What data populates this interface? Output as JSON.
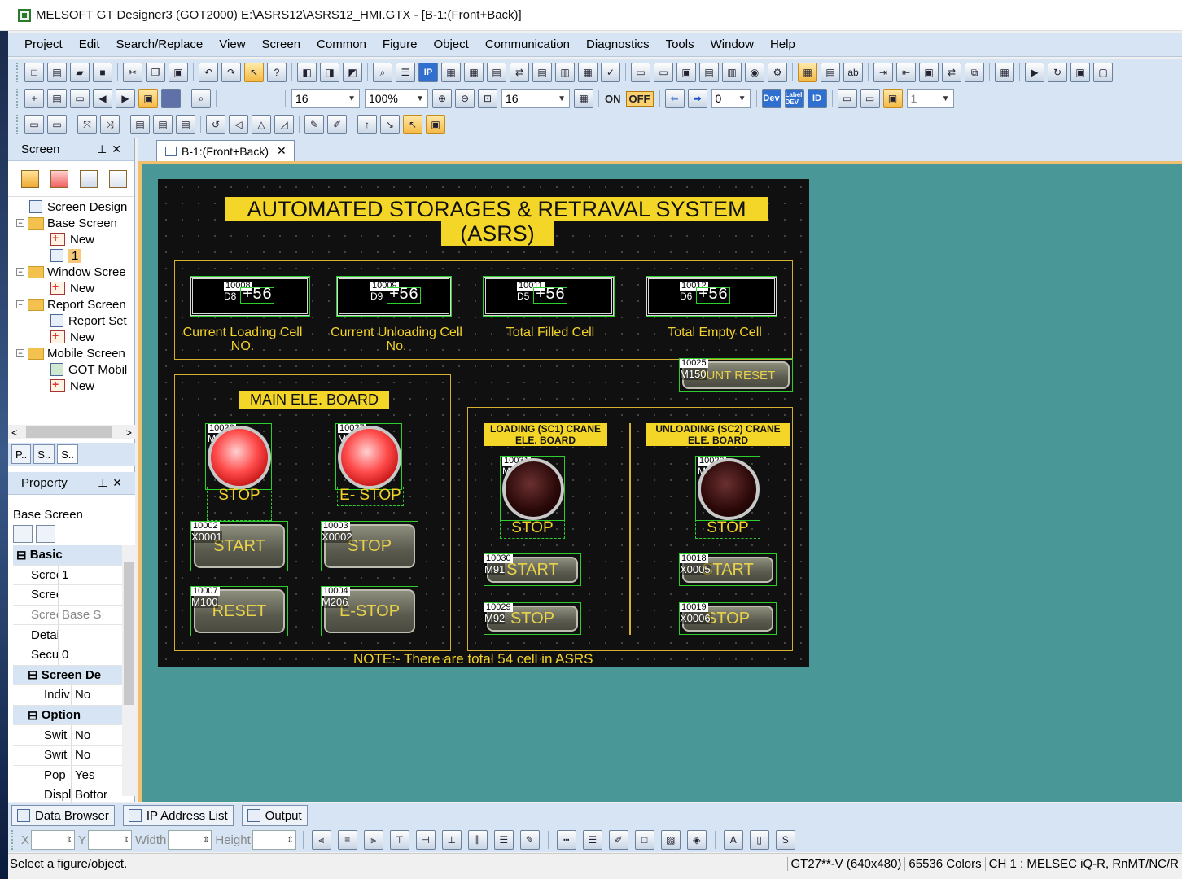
{
  "window": {
    "title": "MELSOFT GT Designer3 (GOT2000) E:\\ASRS12\\ASRS12_HMI.GTX - [B-1:(Front+Back)]"
  },
  "menu": [
    "Project",
    "Edit",
    "Search/Replace",
    "View",
    "Screen",
    "Common",
    "Figure",
    "Object",
    "Communication",
    "Diagnostics",
    "Tools",
    "Window",
    "Help"
  ],
  "toolbar2": {
    "font_size": "16",
    "zoom": "100%",
    "grid": "16",
    "on": "ON",
    "off": "OFF",
    "state": "0",
    "dev": "Dev",
    "label": "Label DEV",
    "id": "ID",
    "layer": "1"
  },
  "screen_panel": {
    "title": "Screen",
    "tree": [
      {
        "label": "Screen Design",
        "level": 1
      },
      {
        "label": "Base Screen",
        "level": 0
      },
      {
        "label": "New",
        "level": 2
      },
      {
        "label": "1",
        "level": 2
      },
      {
        "label": "Window Scree",
        "level": 0
      },
      {
        "label": "New",
        "level": 2
      },
      {
        "label": "Report Screen",
        "level": 0
      },
      {
        "label": "Report Set",
        "level": 2
      },
      {
        "label": "New",
        "level": 2
      },
      {
        "label": "Mobile Screen",
        "level": 0
      },
      {
        "label": "GOT Mobil",
        "level": 2
      },
      {
        "label": "New",
        "level": 2
      }
    ],
    "tabs": [
      "P..",
      "S..",
      "S.."
    ]
  },
  "property_panel": {
    "title": "Property",
    "object": "Base Screen",
    "rows": [
      {
        "type": "cat",
        "k": "Basic"
      },
      {
        "k": "Screen",
        "v": "1"
      },
      {
        "k": "Screen",
        "v": ""
      },
      {
        "k": "Screen",
        "v": "Base S",
        "grey": true
      },
      {
        "k": "Detaile",
        "v": ""
      },
      {
        "k": "Securit",
        "v": "0"
      },
      {
        "type": "subcat",
        "k": "Screen De"
      },
      {
        "k": "Indiv",
        "v": "No",
        "sub": true
      },
      {
        "type": "cat",
        "k": "Option"
      },
      {
        "k": "Swit",
        "v": "No",
        "sub": true
      },
      {
        "k": "Swit",
        "v": "No",
        "sub": true
      },
      {
        "k": "Pop",
        "v": "Yes",
        "sub": true
      },
      {
        "k": "Displ",
        "v": "Bottor",
        "sub": true
      }
    ]
  },
  "doc_tab": "B-1:(Front+Back)",
  "hmi": {
    "title_line1": "AUTOMATED STORAGES & RETRAVAL SYSTEM",
    "title_line2": "(ASRS)",
    "displays": [
      {
        "id": "10008",
        "dev": "D8",
        "value": "+56",
        "label": "Current Loading Cell NO."
      },
      {
        "id": "10009",
        "dev": "D9",
        "value": "+56",
        "label": "Current Unloading Cell No."
      },
      {
        "id": "10011",
        "dev": "D5",
        "value": "+56",
        "label": "Total Filled Cell"
      },
      {
        "id": "10012",
        "dev": "D6",
        "value": "+56",
        "label": "Total Empty Cell"
      }
    ],
    "count_reset": {
      "id": "10025",
      "dev": "M150",
      "label": "OUNT RESET"
    },
    "main_board": {
      "title": "MAIN ELE. BOARD",
      "lamps": [
        {
          "id": "10026",
          "dev": "M90",
          "caption": "STOP"
        },
        {
          "id": "10027",
          "dev": "M0",
          "caption": "E- STOP"
        }
      ],
      "buttons": [
        {
          "id": "10002",
          "dev": "X0001",
          "label": "START"
        },
        {
          "id": "10003",
          "dev": "X0002",
          "label": "STOP"
        },
        {
          "id": "10007",
          "dev": "M100",
          "label": "RESET"
        },
        {
          "id": "10004",
          "dev": "M206",
          "label": "E-STOP"
        }
      ]
    },
    "crane_boards": [
      {
        "title_line1": "LOADING (SC1) CRANE",
        "title_line2": "ELE. BOARD",
        "lamp": {
          "id": "10031",
          "dev": "M0",
          "caption": "STOP"
        },
        "buttons": [
          {
            "id": "10030",
            "dev": "M91",
            "label": "START"
          },
          {
            "id": "10029",
            "dev": "M92",
            "label": "STOP"
          }
        ]
      },
      {
        "title_line1": "UNLOADING (SC2) CRANE",
        "title_line2": "ELE. BOARD",
        "lamp": {
          "id": "10020",
          "dev": "M300",
          "caption": "STOP"
        },
        "buttons": [
          {
            "id": "10018",
            "dev": "X0005",
            "label": "START"
          },
          {
            "id": "10019",
            "dev": "X0006",
            "label": "STOP"
          }
        ]
      }
    ],
    "note": "NOTE:- There are total 54 cell in ASRS"
  },
  "bottom_tabs": [
    "Data Browser",
    "IP Address List",
    "Output"
  ],
  "bottom_toolbar": {
    "x": "X",
    "y": "Y",
    "width": "Width",
    "height": "Height"
  },
  "status": {
    "main": "Select a figure/object.",
    "model": "GT27**-V (640x480)",
    "colors": "65536 Colors",
    "channel": "CH 1 : MELSEC iQ-R, RnMT/NC/R"
  },
  "colors": {
    "hmi_yellow": "#f4d628",
    "canvas_teal": "#4a9797",
    "chrome_blue": "#d6e4f4"
  }
}
